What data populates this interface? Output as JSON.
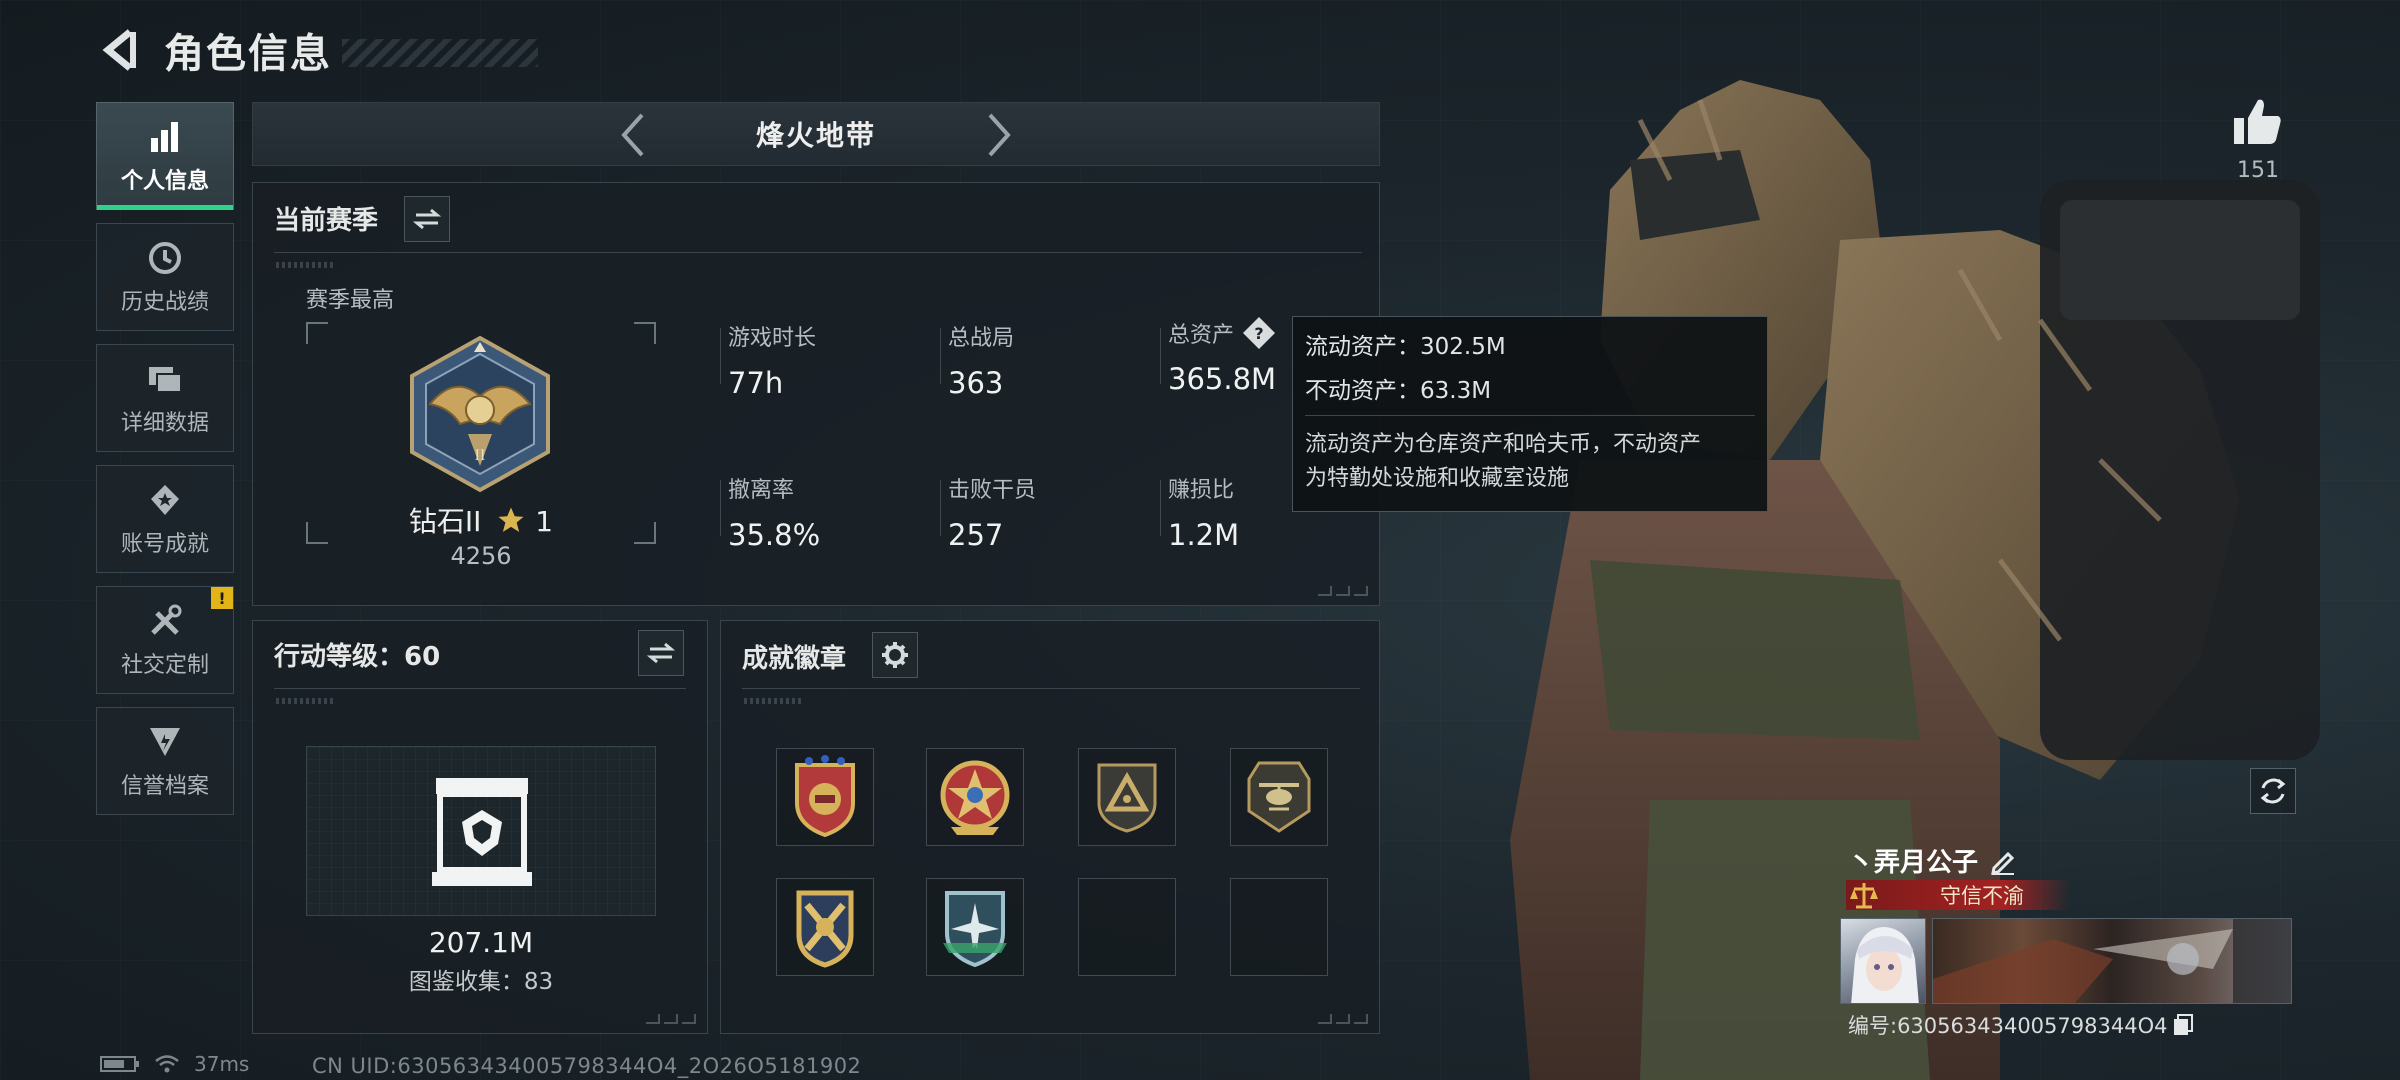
{
  "header": {
    "title": "角色信息"
  },
  "sidebar": {
    "items": [
      {
        "label": "个人信息",
        "icon": "bar-chart-icon",
        "active": true
      },
      {
        "label": "历史战绩",
        "icon": "history-clock-icon"
      },
      {
        "label": "详细数据",
        "icon": "cards-icon"
      },
      {
        "label": "账号成就",
        "icon": "achievement-icon"
      },
      {
        "label": "社交定制",
        "icon": "tools-icon",
        "badge": "!"
      },
      {
        "label": "信誉档案",
        "icon": "reputation-icon"
      }
    ]
  },
  "mode": {
    "title": "烽火地带"
  },
  "season": {
    "title": "当前赛季",
    "best_label": "赛季最高",
    "rank_name": "钻石II",
    "rank_stars": "1",
    "rank_score": "4256",
    "stats": [
      {
        "label": "游戏时长",
        "value": "77h"
      },
      {
        "label": "总战局",
        "value": "363"
      },
      {
        "label": "总资产",
        "value": "365.8M"
      },
      {
        "label": "撤离率",
        "value": "35.8%"
      },
      {
        "label": "击败干员",
        "value": "257"
      },
      {
        "label": "赚损比",
        "value": "1.2M"
      }
    ]
  },
  "tooltip": {
    "liquid": "流动资产：302.5M",
    "fixed": "不动资产：63.3M",
    "desc_line1": "流动资产为仓库资产和哈夫币，不动资产",
    "desc_line2": "为特勤处设施和收藏室设施"
  },
  "action_level": {
    "title": "行动等级：60",
    "value": "207.1M",
    "collection": "图鉴收集：83"
  },
  "badges": {
    "title": "成就徽章",
    "items": [
      {
        "icon": "shield-badge-icon",
        "empty": false
      },
      {
        "icon": "star-badge-icon",
        "empty": false
      },
      {
        "icon": "triangle-badge-icon",
        "empty": false
      },
      {
        "icon": "helicopter-badge-icon",
        "empty": false
      },
      {
        "icon": "crossed-weapons-badge-icon",
        "empty": false
      },
      {
        "icon": "aircraft-badge-icon",
        "empty": false
      },
      {
        "icon": "",
        "empty": true
      },
      {
        "icon": "",
        "empty": true
      }
    ]
  },
  "likes": {
    "count": "151"
  },
  "player": {
    "name": "丶弄月公子",
    "title": "守信不渝",
    "id": "编号:630563434005798344O4"
  },
  "statusbar": {
    "ping": "37ms",
    "uid": "CN UID:630563434005798344O4_2O26O5181902"
  },
  "colors": {
    "accent_green": "#2fd48a",
    "notice_yellow": "#e3b417",
    "title_red": "#a32222"
  }
}
